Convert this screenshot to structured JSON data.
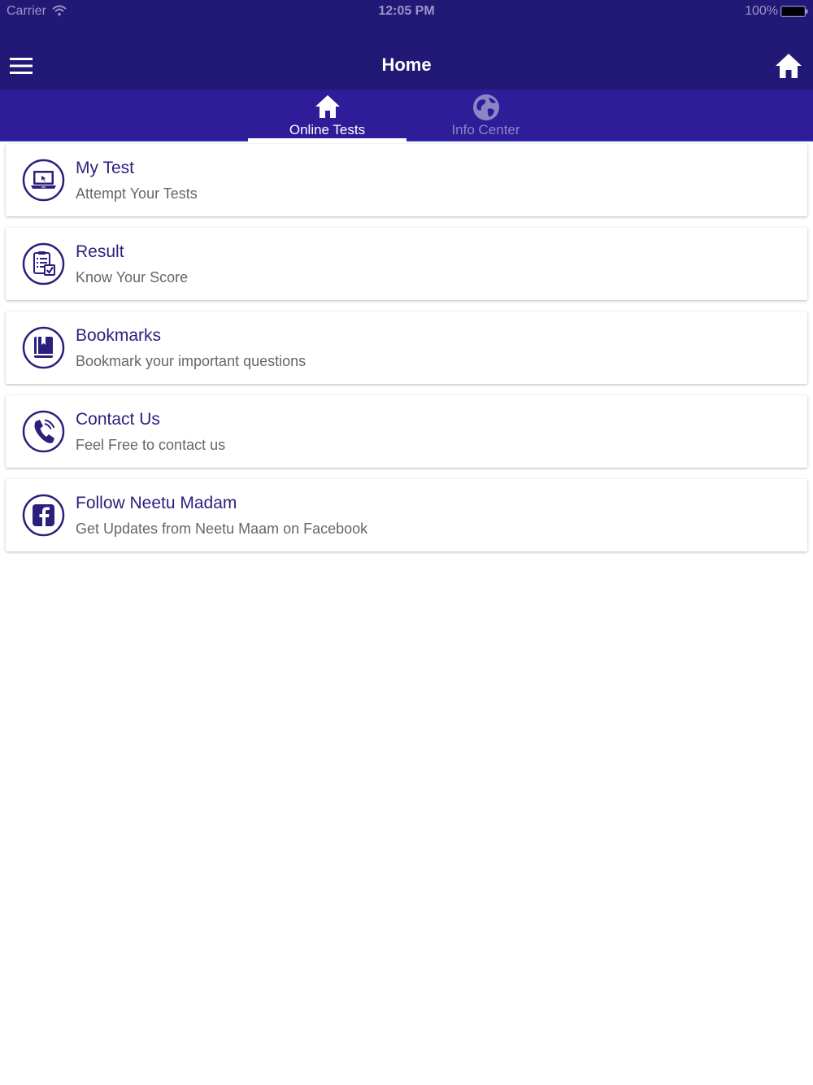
{
  "status_bar": {
    "carrier": "Carrier",
    "time": "12:05 PM",
    "battery": "100%"
  },
  "nav": {
    "title": "Home",
    "left_icon": "menu-icon",
    "right_icon": "home-icon"
  },
  "tabs": [
    {
      "label": "Online Tests",
      "icon": "home-icon",
      "active": true
    },
    {
      "label": "Info Center",
      "icon": "globe-icon",
      "active": false
    }
  ],
  "menu": {
    "items": [
      {
        "title": "My Test",
        "subtitle": "Attempt Your Tests",
        "icon": "laptop-icon"
      },
      {
        "title": "Result",
        "subtitle": "Know Your Score",
        "icon": "clipboard-check-icon"
      },
      {
        "title": "Bookmarks",
        "subtitle": "Bookmark your important questions",
        "icon": "book-icon"
      },
      {
        "title": "Contact Us",
        "subtitle": "Feel Free to contact us",
        "icon": "phone-icon"
      },
      {
        "title": "Follow Neetu Madam",
        "subtitle": "Get Updates from Neetu Maam on Facebook",
        "icon": "facebook-icon"
      }
    ]
  },
  "colors": {
    "header_bg": "#221875",
    "tab_bar_bg": "#2f1c98",
    "accent": "#2b1f7e",
    "inactive_tab": "#8d86c4",
    "subtitle_text": "#666666"
  }
}
